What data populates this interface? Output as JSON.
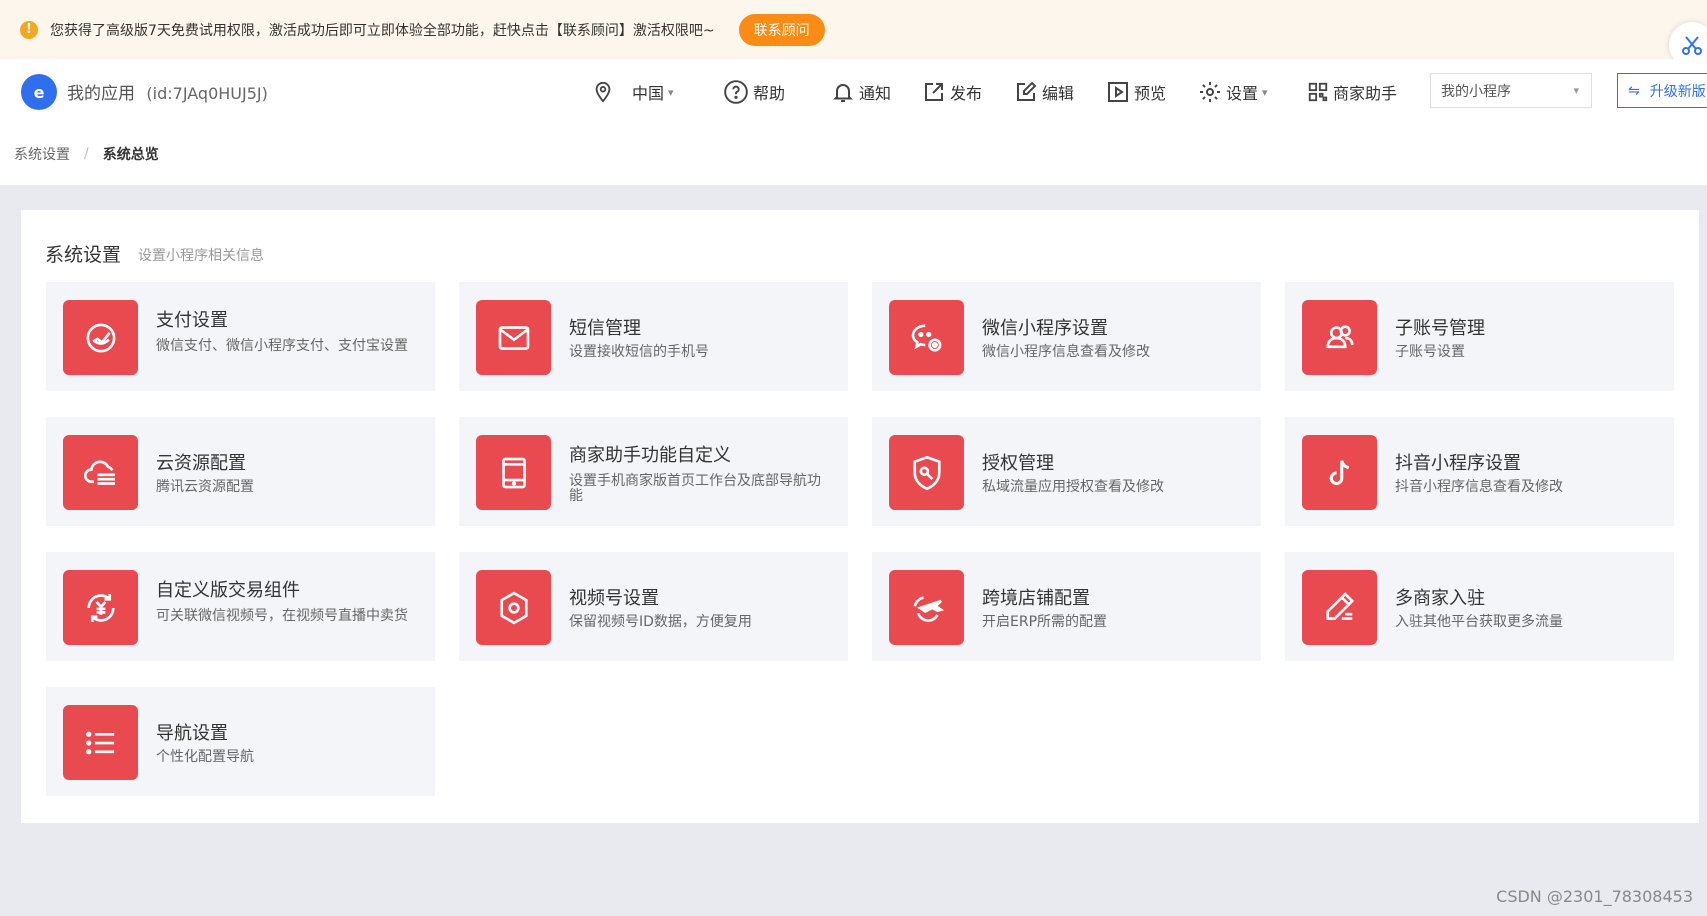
{
  "notice": {
    "message": "您获得了高级版7天免费试用权限，激活成功后即可立即体验全部功能，赶快点击【联系顾问】激活权限吧~",
    "contact_button": "联系顾问"
  },
  "header": {
    "app_name": "我的应用",
    "app_id": "(id:7JAq0HUJ5J)",
    "nav": {
      "region": "中国",
      "help": "帮助",
      "notify": "通知",
      "publish": "发布",
      "edit": "编辑",
      "preview": "预览",
      "settings": "设置",
      "merchant": "商家助手"
    },
    "program_select": "我的小程序",
    "upgrade": "升级新版"
  },
  "breadcrumb": {
    "parent": "系统设置",
    "separator": "/",
    "current": "系统总览"
  },
  "panel": {
    "title": "系统设置",
    "subtitle": "设置小程序相关信息",
    "tiles": [
      {
        "title": "支付设置",
        "desc": "微信支付、微信小程序支付、支付宝设置",
        "icon": "payment-icon"
      },
      {
        "title": "短信管理",
        "desc": "设置接收短信的手机号",
        "icon": "mail-icon"
      },
      {
        "title": "微信小程序设置",
        "desc": "微信小程序信息查看及修改",
        "icon": "wechat-settings-icon"
      },
      {
        "title": "子账号管理",
        "desc": "子账号设置",
        "icon": "users-icon"
      },
      {
        "title": "云资源配置",
        "desc": "腾讯云资源配置",
        "icon": "cloud-icon"
      },
      {
        "title": "商家助手功能自定义",
        "desc": "设置手机商家版首页工作台及底部导航功能",
        "icon": "tablet-icon"
      },
      {
        "title": "授权管理",
        "desc": "私域流量应用授权查看及修改",
        "icon": "shield-key-icon"
      },
      {
        "title": "抖音小程序设置",
        "desc": "抖音小程序信息查看及修改",
        "icon": "tiktok-icon"
      },
      {
        "title": "自定义版交易组件",
        "desc": "可关联微信视频号，在视频号直播中卖货",
        "icon": "yuan-exchange-icon"
      },
      {
        "title": "视频号设置",
        "desc": "保留视频号ID数据，方便复用",
        "icon": "hexagon-icon"
      },
      {
        "title": "跨境店铺配置",
        "desc": "开启ERP所需的配置",
        "icon": "plane-icon"
      },
      {
        "title": "多商家入驻",
        "desc": "入驻其他平台获取更多流量",
        "icon": "pen-edit-icon"
      },
      {
        "title": "导航设置",
        "desc": "个性化配置导航",
        "icon": "list-icon"
      }
    ]
  },
  "watermark": "CSDN @2301_78308453",
  "colors": {
    "accent": "#e84a50",
    "primary": "#2f6fed",
    "warning": "#fa8c16"
  }
}
